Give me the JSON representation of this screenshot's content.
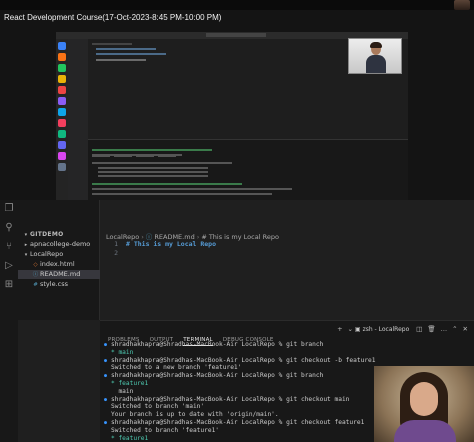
{
  "video": {
    "title": "React Development Course(17-Oct-2023-8:45 PM-10:00 PM)"
  },
  "explorer": {
    "header": "GITDEMO",
    "items": [
      {
        "label": "apnacollege-demo",
        "type": "folder",
        "expanded": false,
        "depth": 0
      },
      {
        "label": "LocalRepo",
        "type": "folder",
        "expanded": true,
        "depth": 0
      },
      {
        "label": "index.html",
        "type": "file",
        "icon": "html-file-icon",
        "depth": 1
      },
      {
        "label": "README.md",
        "type": "file",
        "icon": "info-file-icon",
        "depth": 1
      },
      {
        "label": "style.css",
        "type": "file",
        "icon": "css-file-icon",
        "depth": 1
      }
    ]
  },
  "editor": {
    "breadcrumb": [
      "LocalRepo",
      "README.md",
      "# This is my Local Repo"
    ],
    "lines": [
      {
        "num": "1",
        "text": "# This is my Local Repo"
      },
      {
        "num": "2",
        "text": ""
      }
    ]
  },
  "panel": {
    "tabs": [
      "PROBLEMS",
      "OUTPUT",
      "TERMINAL",
      "DEBUG CONSOLE"
    ],
    "active_tab": "TERMINAL",
    "terminal_label": "zsh - LocalRepo"
  },
  "terminal": {
    "lines": [
      {
        "dot": true,
        "text": "shradhakhapra@Shradhas-MacBook-Air LocalRepo % git branch"
      },
      {
        "dot": false,
        "text": "* main"
      },
      {
        "dot": true,
        "text": "shradhakhapra@Shradhas-MacBook-Air LocalRepo % git checkout -b feature1"
      },
      {
        "dot": false,
        "text": "Switched to a new branch 'feature1'"
      },
      {
        "dot": true,
        "text": "shradhakhapra@Shradhas-MacBook-Air LocalRepo % git branch"
      },
      {
        "dot": false,
        "text": "* feature1"
      },
      {
        "dot": false,
        "text": "  main"
      },
      {
        "dot": true,
        "text": "shradhakhapra@Shradhas-MacBook-Air LocalRepo % git checkout main"
      },
      {
        "dot": false,
        "text": "Switched to branch 'main'"
      },
      {
        "dot": false,
        "text": "Your branch is up to date with 'origin/main'."
      },
      {
        "dot": true,
        "text": "shradhakhapra@Shradhas-MacBook-Air LocalRepo % git checkout feature1"
      },
      {
        "dot": false,
        "text": "Switched to branch 'feature1'"
      },
      {
        "dot": false,
        "text": "* feature1"
      }
    ]
  },
  "colors": {
    "accent": "#3794ff",
    "heading": "#569cd6"
  }
}
